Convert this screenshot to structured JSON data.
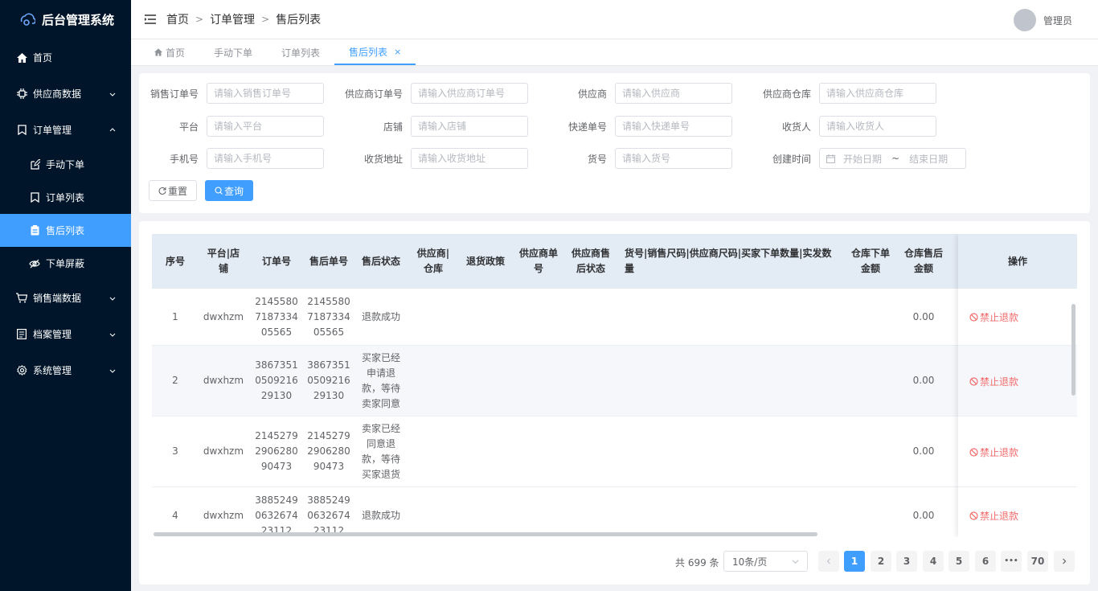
{
  "app": {
    "title": "后台管理系统"
  },
  "sidebar": {
    "items": [
      {
        "label": "首页",
        "icon": "home-icon"
      },
      {
        "label": "供应商数据",
        "icon": "chip-icon"
      },
      {
        "label": "订单管理",
        "icon": "bookmark-icon"
      },
      {
        "label": "销售端数据",
        "icon": "cart-icon"
      },
      {
        "label": "档案管理",
        "icon": "file-icon"
      },
      {
        "label": "系统管理",
        "icon": "gear-icon"
      }
    ],
    "sub": [
      {
        "label": "手动下单",
        "icon": "edit-icon"
      },
      {
        "label": "订单列表",
        "icon": "bookmark-icon"
      },
      {
        "label": "售后列表",
        "icon": "clipboard-icon"
      },
      {
        "label": "下单屏蔽",
        "icon": "eye-off-icon"
      }
    ]
  },
  "header": {
    "breadcrumb": [
      "首页",
      "订单管理",
      "售后列表"
    ],
    "user": "管理员"
  },
  "tabs": [
    "首页",
    "手动下单",
    "订单列表",
    "售后列表"
  ],
  "filter": {
    "fields": [
      {
        "label": "销售订单号",
        "placeholder": "请输入销售订单号"
      },
      {
        "label": "供应商订单号",
        "placeholder": "请输入供应商订单号"
      },
      {
        "label": "供应商",
        "placeholder": "请输入供应商"
      },
      {
        "label": "供应商仓库",
        "placeholder": "请输入供应商仓库"
      },
      {
        "label": "平台",
        "placeholder": "请输入平台"
      },
      {
        "label": "店铺",
        "placeholder": "请输入店铺"
      },
      {
        "label": "快递单号",
        "placeholder": "请输入快递单号"
      },
      {
        "label": "收货人",
        "placeholder": "请输入收货人"
      },
      {
        "label": "手机号",
        "placeholder": "请输入手机号"
      },
      {
        "label": "收货地址",
        "placeholder": "请输入收货地址"
      },
      {
        "label": "货号",
        "placeholder": "请输入货号"
      }
    ],
    "date": {
      "label": "创建时间",
      "start": "开始日期",
      "sep": "~",
      "end": "结束日期"
    },
    "reset": "重置",
    "query": "查询"
  },
  "table": {
    "columns": [
      "序号",
      "平台|店铺",
      "订单号",
      "售后单号",
      "售后状态",
      "供应商|仓库",
      "退货政策",
      "供应商单号",
      "供应商售后状态",
      "货号|销售尺码|供应商尺码|买家下单数量|实发数量",
      "仓库下单金额",
      "仓库售后金额",
      "操作"
    ],
    "rows": [
      {
        "index": "1",
        "shop": "dwxhzm",
        "order": "2145580718733405565",
        "after": "2145580718733405565",
        "status": "退款成功",
        "amount": "0.00",
        "op": "禁止退款"
      },
      {
        "index": "2",
        "shop": "dwxhzm",
        "order": "3867351050921629130",
        "after": "3867351050921629130",
        "status": "买家已经申请退款，等待卖家同意",
        "amount": "0.00",
        "op": "禁止退款"
      },
      {
        "index": "3",
        "shop": "dwxhzm",
        "order": "2145279290628090473",
        "after": "2145279290628090473",
        "status": "卖家已经同意退款，等待买家退货",
        "amount": "0.00",
        "op": "禁止退款"
      },
      {
        "index": "4",
        "shop": "dwxhzm",
        "order": "3885249063267423112",
        "after": "3885249063267423112",
        "status": "退款成功",
        "amount": "0.00",
        "op": "禁止退款"
      }
    ]
  },
  "pagination": {
    "total": "共 699 条",
    "page_size": "10条/页",
    "pages": [
      "1",
      "2",
      "3",
      "4",
      "5",
      "6",
      "•••",
      "70"
    ],
    "current": "1"
  },
  "colors": {
    "sidebar_bg": "#001529",
    "primary": "#409eff",
    "danger": "#f56c6c"
  }
}
